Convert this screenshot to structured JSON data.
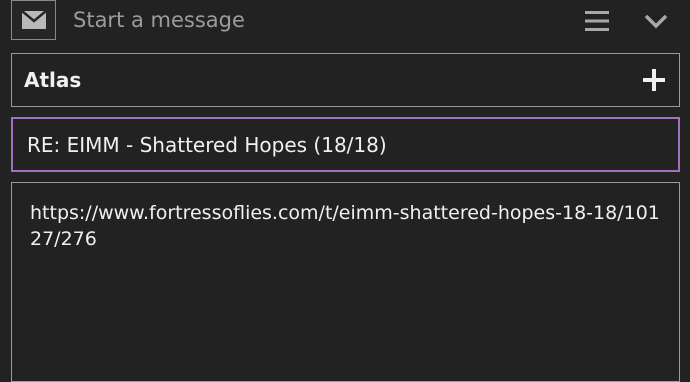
{
  "header": {
    "title": "Start a message",
    "mail_icon": "envelope-icon",
    "menu_icon": "hamburger-menu-icon",
    "collapse_icon": "chevron-down-icon"
  },
  "recipient": {
    "name": "Atlas",
    "add_icon": "plus-icon"
  },
  "subject": {
    "value": "RE: EIMM - Shattered Hopes (18/18)"
  },
  "body": {
    "value": "https://www.fortressoflies.com/t/eimm-shattered-hopes-18-18/10127/276"
  },
  "colors": {
    "background": "#222222",
    "border": "#9a9a9a",
    "focus_border": "#a56fbf",
    "placeholder": "#9c9c9c",
    "text": "#f0f0f0"
  }
}
